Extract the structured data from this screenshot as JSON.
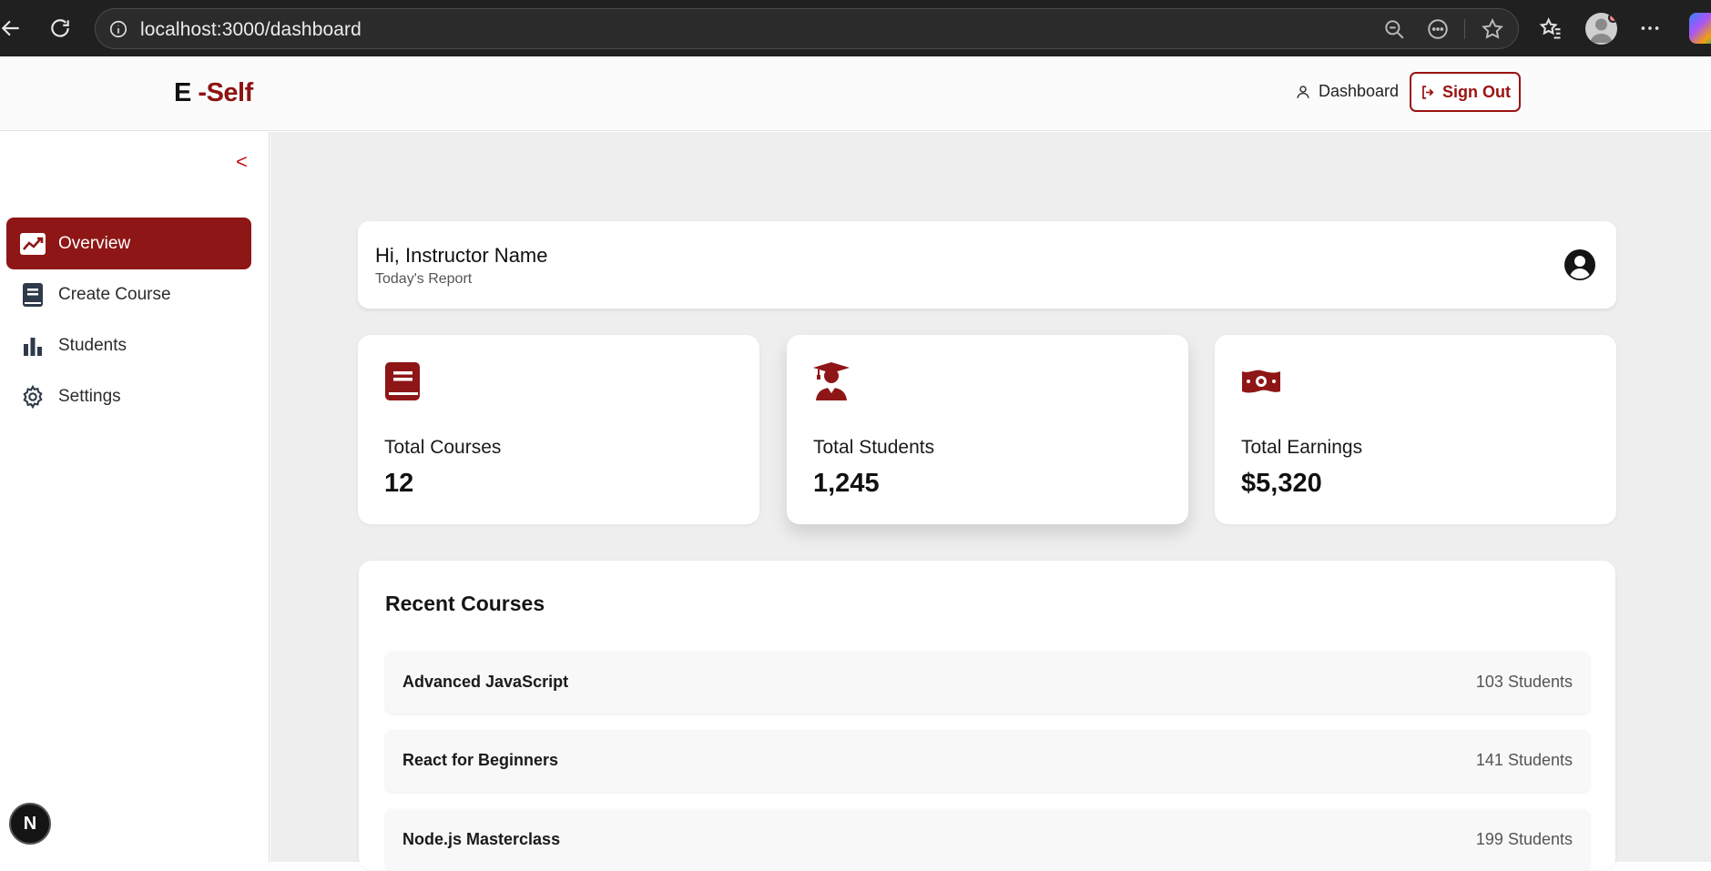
{
  "browser": {
    "url": "localhost:3000/dashboard"
  },
  "header": {
    "logo_e": "E",
    "logo_self": "-Self",
    "dashboard_label": "Dashboard",
    "signout_label": "Sign Out",
    "brand_color": "#8f1111"
  },
  "sidebar": {
    "collapse_label": "<",
    "items": [
      {
        "label": "Overview",
        "icon": "chart-line-icon",
        "active": true
      },
      {
        "label": "Create Course",
        "icon": "book-icon",
        "active": false
      },
      {
        "label": "Students",
        "icon": "bar-chart-icon",
        "active": false
      },
      {
        "label": "Settings",
        "icon": "gear-icon",
        "active": false
      }
    ],
    "badge": "N"
  },
  "greeting": {
    "title": "Hi, Instructor Name",
    "subtitle": "Today's Report"
  },
  "stats": [
    {
      "label": "Total Courses",
      "value": "12",
      "icon": "book-icon"
    },
    {
      "label": "Total Students",
      "value": "1,245",
      "icon": "graduate-icon"
    },
    {
      "label": "Total Earnings",
      "value": "$5,320",
      "icon": "money-icon"
    }
  ],
  "recent": {
    "title": "Recent Courses",
    "courses": [
      {
        "name": "Advanced JavaScript",
        "students": "103 Students"
      },
      {
        "name": "React for Beginners",
        "students": "141 Students"
      },
      {
        "name": "Node.js Masterclass",
        "students": "199 Students"
      }
    ]
  }
}
